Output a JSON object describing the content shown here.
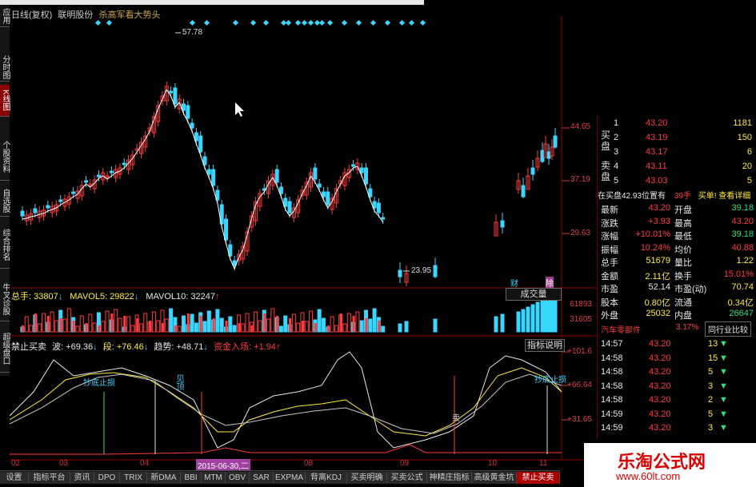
{
  "header": {
    "title_parts": [
      "日线(复权)",
      "联明股份"
    ],
    "tip": "杀高军看大势头"
  },
  "side_tabs": [
    "应用",
    "分时图",
    "K线图",
    "个股资料",
    "自选股",
    "综合排名",
    "牛叉诊股",
    "超级盘口"
  ],
  "price_axis": [
    "44.65",
    "37.19",
    "29.63"
  ],
  "price_marks": {
    "high": "57.78",
    "low": "23.95"
  },
  "vol_header": {
    "total": "总手: 33807",
    "ma5": "MAVOL5: 29822",
    "ma10": "MAVOL10: 32247"
  },
  "vol_button": "成交量",
  "vol_axis": [
    "61893",
    "31605"
  ],
  "ind_header": {
    "name": "禁止买卖",
    "wave": "波: +69.36",
    "duan": "段: +76.46",
    "trend": "趋势: +48.71",
    "fund": "资金入场: +1.94"
  },
  "ind_button": "指标说明",
  "ind_axis": [
    "+101.6",
    "+66.64",
    "+31.65"
  ],
  "ind_labels": [
    "抄底止损",
    "见顶",
    "卖",
    "抄底止损"
  ],
  "date_ticks": [
    "02",
    "03",
    "04",
    "2015-06-30,二",
    "08",
    "09",
    "10",
    "11"
  ],
  "bottom_tabs": [
    "设置",
    "指标平台",
    "资讯",
    "DPO",
    "TRIX",
    "新DMA",
    "BBI",
    "MTM",
    "OBV",
    "SAR",
    "EXPMA",
    "背离KDJ",
    "买卖明确",
    "买卖公式",
    "神精庄指标",
    "高级黄金坑",
    "禁止买卖"
  ],
  "badges": [
    "财",
    "除"
  ],
  "orderbook": {
    "buy_label": "买盘",
    "sell_label": "卖盘",
    "buys": [
      {
        "lvl": "1",
        "price": "43.20",
        "vol": "1181"
      },
      {
        "lvl": "2",
        "price": "43.19",
        "vol": "150"
      },
      {
        "lvl": "3",
        "price": "43.17",
        "vol": "6"
      },
      {
        "lvl": "4",
        "price": "43.11",
        "vol": "20"
      },
      {
        "lvl": "5",
        "price": "43.03",
        "vol": "5"
      }
    ],
    "summary_left": "在买盘42.93位置有",
    "summary_mid": "39手",
    "summary_right": "买单! 查看详细",
    "stats": [
      [
        "最新",
        "43.20",
        "开盘",
        "39.18"
      ],
      [
        "涨跌",
        "+3.93",
        "最高",
        "43.20"
      ],
      [
        "涨幅",
        "+10.01%",
        "最低",
        "39.18"
      ],
      [
        "振幅",
        "10.24%",
        "均价",
        "40.88"
      ],
      [
        "总手",
        "51679",
        "量比",
        "1.22"
      ],
      [
        "金额",
        "2.11亿",
        "换手",
        "15.01%"
      ],
      [
        "市盈",
        "52.14",
        "市盈(动)",
        "70.74"
      ],
      [
        "股本",
        "0.80亿",
        "流通",
        "0.34亿"
      ],
      [
        "外盘",
        "25032",
        "内盘",
        "26647"
      ]
    ],
    "industry": "汽车零部件",
    "industry_pct": "3.17%",
    "compare": "同行业比较",
    "ticks": [
      {
        "t": "14:57",
        "p": "43.20",
        "v": "13"
      },
      {
        "t": "14:58",
        "p": "43.20",
        "v": "15"
      },
      {
        "t": "14:58",
        "p": "43.20",
        "v": "5"
      },
      {
        "t": "14:58",
        "p": "43.20",
        "v": "3"
      },
      {
        "t": "14:58",
        "p": "43.20",
        "v": "2"
      },
      {
        "t": "14:59",
        "p": "43.20",
        "v": "5"
      },
      {
        "t": "14:59",
        "p": "43.20",
        "v": "3"
      }
    ]
  },
  "watermark": {
    "title": "乐淘公式网",
    "url": "www.60lt.com"
  },
  "colors": {
    "up": "#ff3b3b",
    "down": "#39d6ff",
    "ma": "#ffffff",
    "bg": "#000000"
  }
}
